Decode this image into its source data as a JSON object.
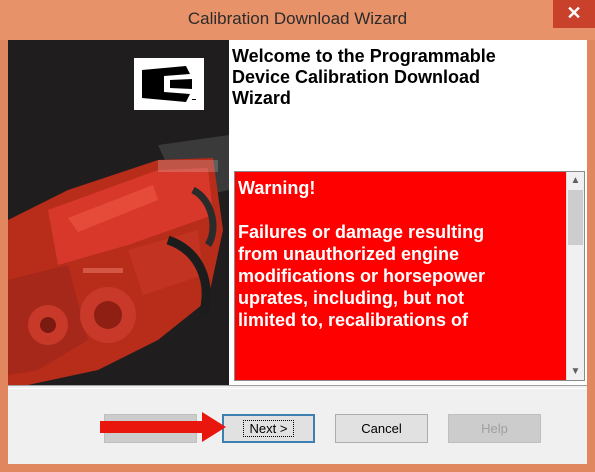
{
  "window": {
    "title": "Calibration Download Wizard",
    "close_glyph": "✕"
  },
  "logo": {
    "icon": "cummins-logo"
  },
  "welcome": {
    "heading": "Welcome to the Programmable\nDevice Calibration Download\nWizard"
  },
  "warning": {
    "text": "Warning!\n\nFailures or damage resulting\nfrom unauthorized engine\nmodifications or horsepower\nuprates, including, but not\nlimited to, recalibrations of",
    "background": "#ff0000",
    "scroll_up": "▲",
    "scroll_down": "▼"
  },
  "buttons": {
    "back": "< Back",
    "next": "Next >",
    "cancel": "Cancel",
    "help": "Help"
  },
  "annotation": {
    "arrow_color": "#e8160d"
  }
}
